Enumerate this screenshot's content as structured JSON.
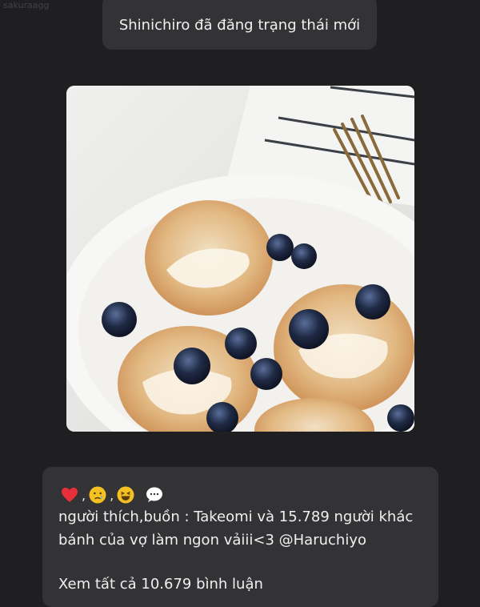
{
  "watermark": "sakuraagg",
  "banner": {
    "text": "Shinichiro đã đăng trạng thái mới"
  },
  "post": {
    "image_alt": "pancakes with blueberries",
    "reactions": [
      {
        "icon": "heart-icon",
        "color": "#e8303a"
      },
      {
        "icon": "crying-face-icon",
        "color": "#f5c021"
      },
      {
        "icon": "laughing-face-icon",
        "color": "#f5c021"
      },
      {
        "icon": "speech-bubble-icon",
        "color": "#ffffff"
      }
    ],
    "likes_text": "người thích,buồn : Takeomi và 15.789 người khác",
    "caption": "bánh của vợ làm ngon vảiii<3 @Haruchiyo",
    "view_comments": "Xem tất cả 10.679 bình luận"
  }
}
